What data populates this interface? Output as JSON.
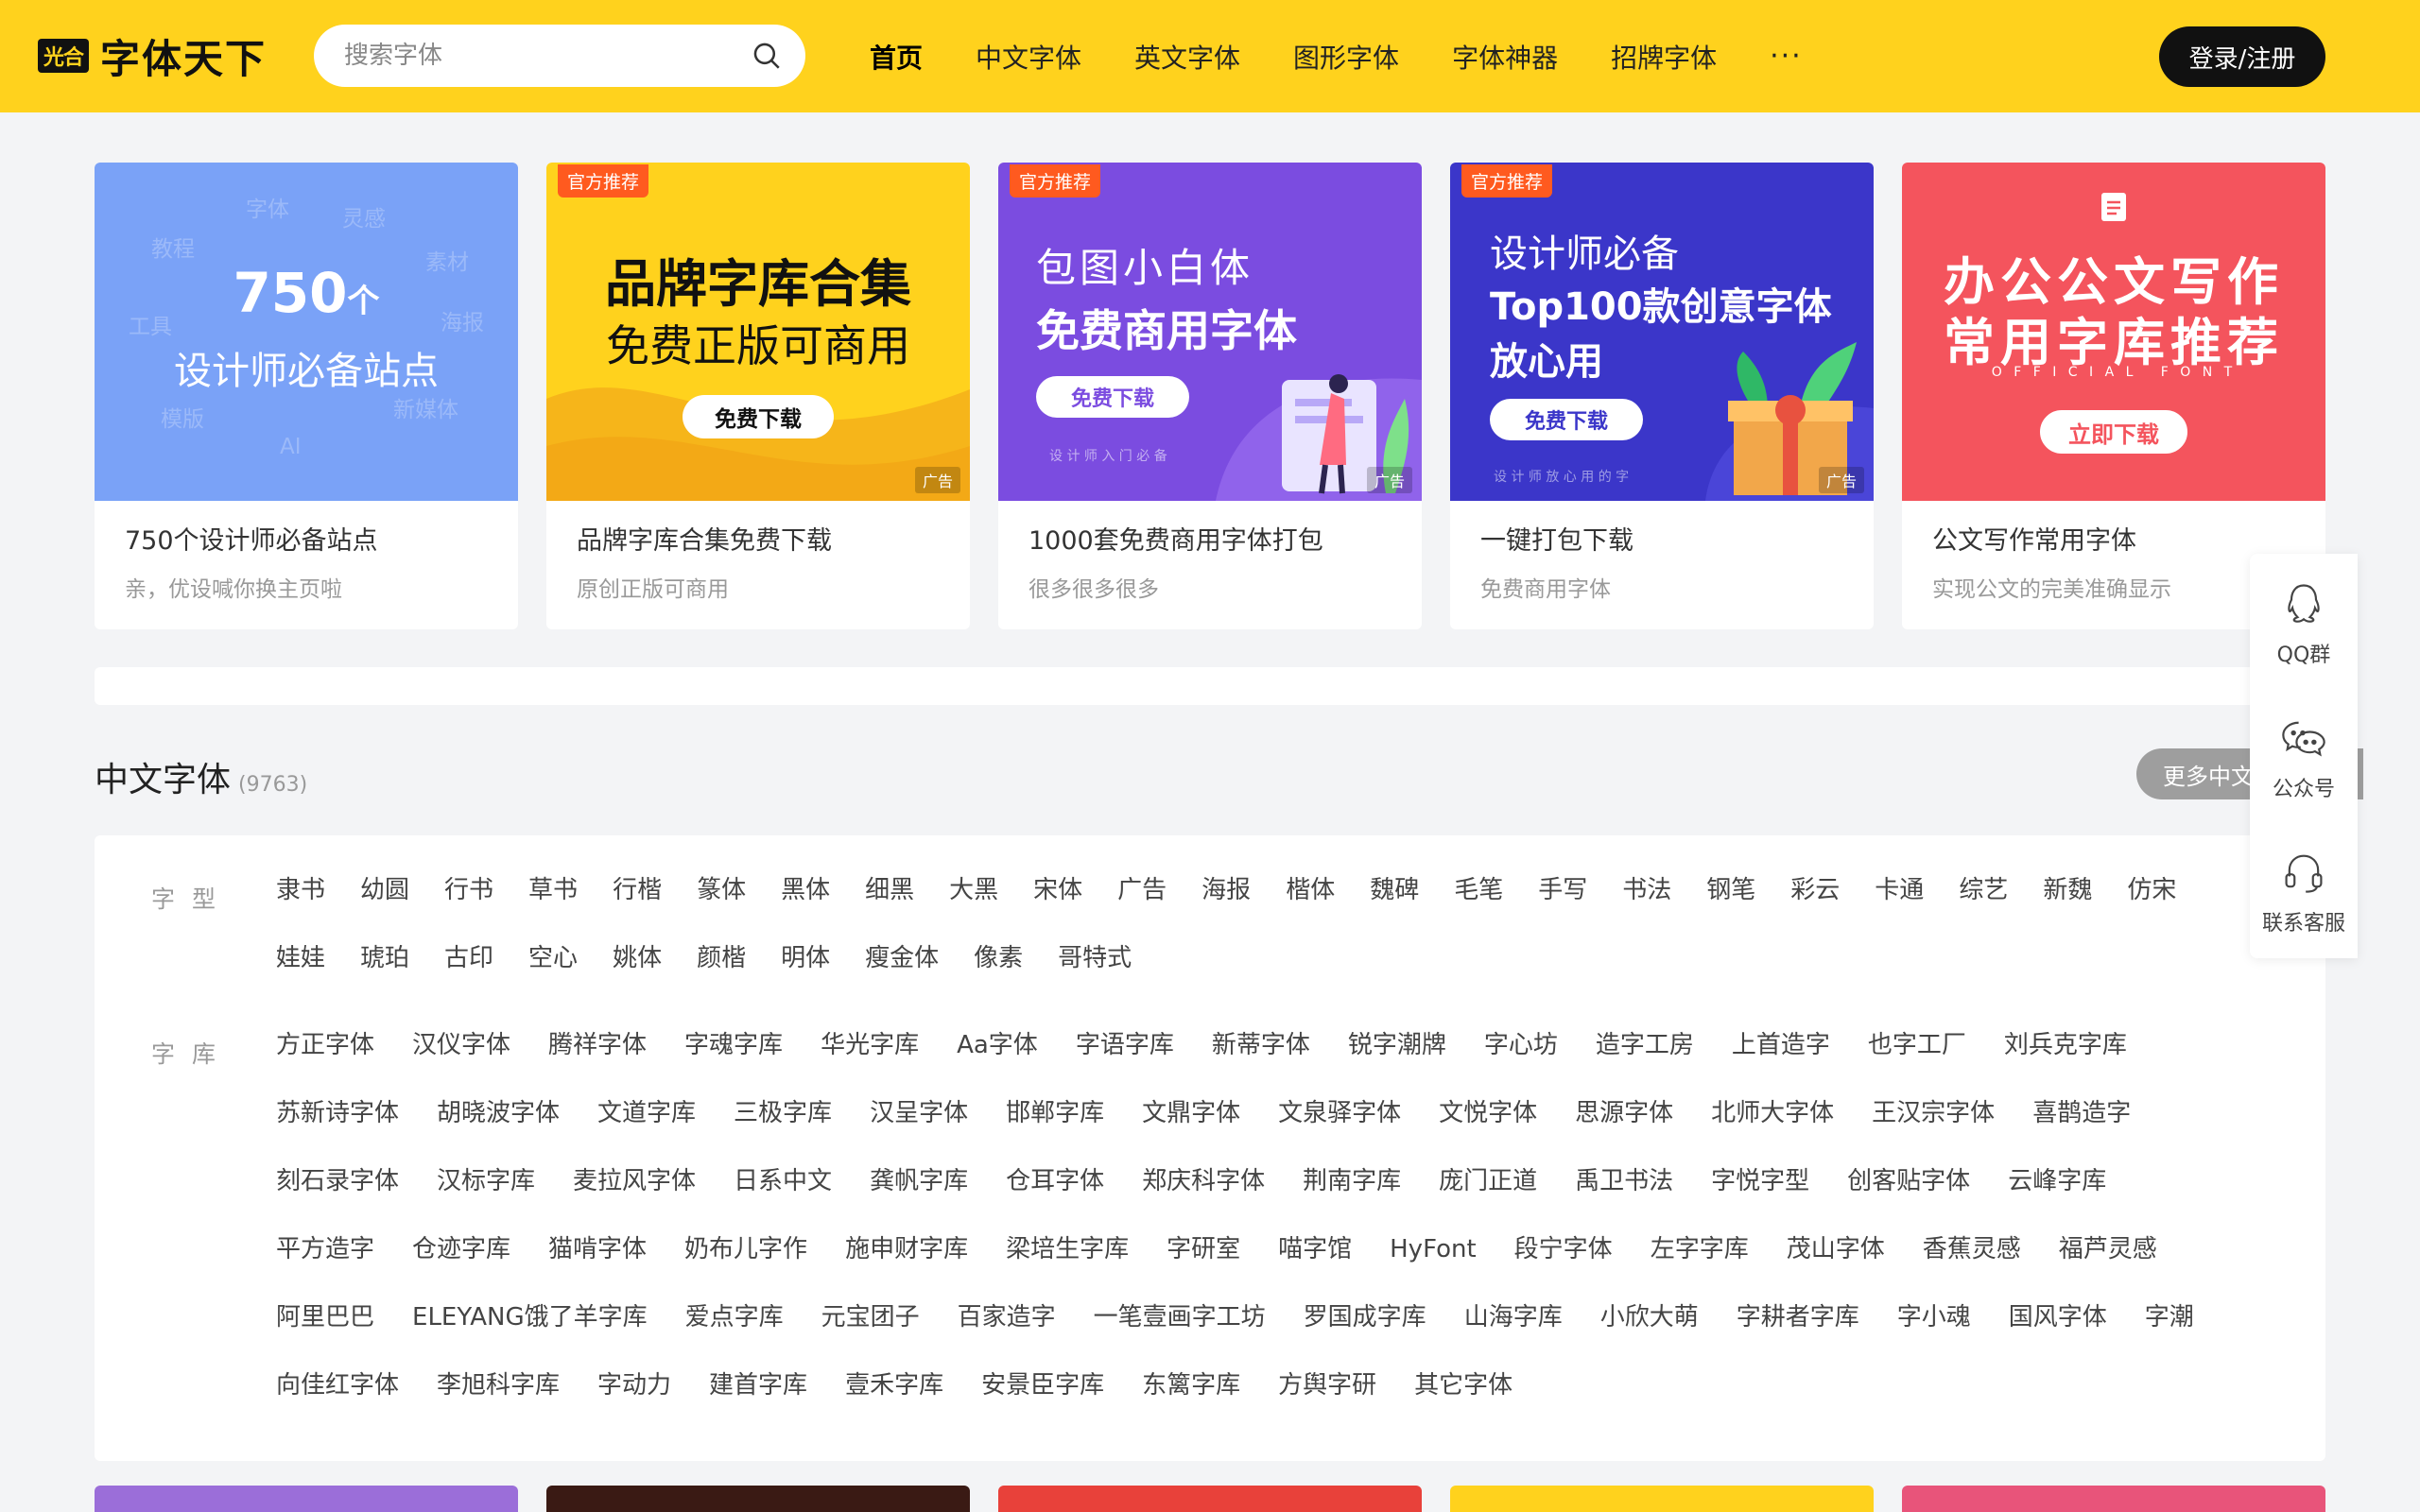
{
  "header": {
    "logo_badge": "光合",
    "logo_text": "字体天下",
    "search_placeholder": "搜索字体",
    "nav": [
      "首页",
      "中文字体",
      "英文字体",
      "图形字体",
      "字体神器",
      "招牌字体"
    ],
    "nav_more": "···",
    "login": "登录/注册"
  },
  "cards": [
    {
      "title": "750个设计师必备站点",
      "subtitle": "亲，优设喊你换主页啦",
      "banner": {
        "number": "750",
        "unit": "个",
        "line": "设计师必备站点",
        "floaters": [
          "字体",
          "灵感",
          "教程",
          "素材",
          "工具",
          "海报",
          "模版",
          "新媒体",
          "AI"
        ]
      }
    },
    {
      "title": "品牌字库合集免费下载",
      "subtitle": "原创正版可商用",
      "badge": "官方推荐",
      "ad": "广告",
      "banner": {
        "line1": "品牌字库合集",
        "line2": "免费正版可商用",
        "button": "免费下载"
      }
    },
    {
      "title": "1000套免费商用字体打包",
      "subtitle": "很多很多很多",
      "badge": "官方推荐",
      "ad": "广告",
      "banner": {
        "line1": "包图小白体",
        "line2": "免费商用字体",
        "button": "免费下载",
        "small": "设 计 师 入 门 必 备"
      }
    },
    {
      "title": "一键打包下载",
      "subtitle": "免费商用字体",
      "badge": "官方推荐",
      "ad": "广告",
      "banner": {
        "line1": "设计师必备",
        "line2": "Top100款创意字体",
        "line3": "放心用",
        "button": "免费下载",
        "small": "设 计 师 放 心 用 的 字"
      }
    },
    {
      "title": "公文写作常用字体",
      "subtitle": "实现公文的完美准确显示",
      "banner": {
        "line1": "办公公文写作",
        "line2": "常用字库推荐",
        "small": "O F F I C I A L   F O N T",
        "button": "立即下载"
      }
    }
  ],
  "section": {
    "title": "中文字体",
    "count": "(9763)",
    "more": "更多中文"
  },
  "rows": [
    {
      "label": "字型",
      "tags": [
        "隶书",
        "幼圆",
        "行书",
        "草书",
        "行楷",
        "篆体",
        "黑体",
        "细黑",
        "大黑",
        "宋体",
        "广告",
        "海报",
        "楷体",
        "魏碑",
        "毛笔",
        "手写",
        "书法",
        "钢笔",
        "彩云",
        "卡通",
        "综艺",
        "新魏",
        "仿宋",
        "娃娃",
        "琥珀",
        "古印",
        "空心",
        "姚体",
        "颜楷",
        "明体",
        "瘦金体",
        "像素",
        "哥特式"
      ]
    },
    {
      "label": "字库",
      "tags": [
        "方正字体",
        "汉仪字体",
        "腾祥字体",
        "字魂字库",
        "华光字库",
        "Aa字体",
        "字语字库",
        "新蒂字体",
        "锐字潮牌",
        "字心坊",
        "造字工房",
        "上首造字",
        "也字工厂",
        "刘兵克字库",
        "苏新诗字体",
        "胡晓波字体",
        "文道字库",
        "三极字库",
        "汉呈字体",
        "邯郸字库",
        "文鼎字体",
        "文泉驿字体",
        "文悦字体",
        "思源字体",
        "北师大字体",
        "王汉宗字体",
        "喜鹊造字",
        "刻石录字体",
        "汉标字库",
        "麦拉风字体",
        "日系中文",
        "龚帆字库",
        "仓耳字体",
        "郑庆科字体",
        "荆南字库",
        "庞门正道",
        "禹卫书法",
        "字悦字型",
        "创客贴字体",
        "云峰字库",
        "平方造字",
        "仓迹字库",
        "猫啃字体",
        "奶布儿字作",
        "施申财字库",
        "梁培生字库",
        "字研室",
        "喵字馆",
        "HyFont",
        "段宁字体",
        "左字字库",
        "茂山字体",
        "香蕉灵感",
        "福芦灵感",
        "阿里巴巴",
        "ELEYANG饿了羊字库",
        "爱点字库",
        "元宝团子",
        "百家造字",
        "一笔壹画字工坊",
        "罗国成字库",
        "山海字库",
        "小欣大萌",
        "字耕者字库",
        "字小魂",
        "国风字体",
        "字潮",
        "向佳红字体",
        "李旭科字库",
        "字动力",
        "建首字库",
        "壹禾字库",
        "安景臣字库",
        "东篱字库",
        "方舆字研",
        "其它字体"
      ]
    }
  ],
  "side": [
    "QQ群",
    "公众号",
    "联系客服"
  ],
  "colors": {
    "brand": "#ffd21d",
    "dark": "#111111",
    "official_badge": "#ff5a1f"
  }
}
